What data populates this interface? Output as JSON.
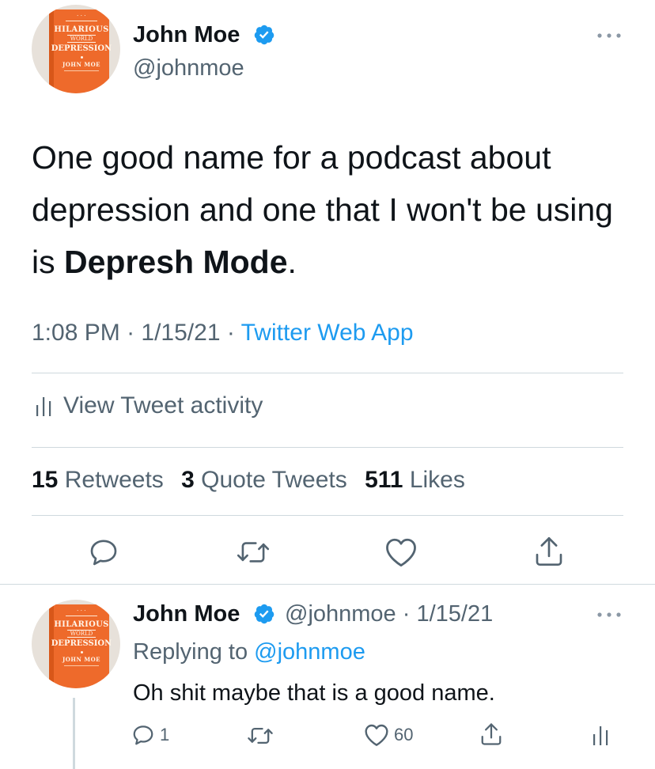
{
  "main_tweet": {
    "author_name": "John Moe",
    "author_handle": "@johnmoe",
    "text_before": "One good name for a podcast about depression and one that I won't be using is ",
    "text_bold": "Depresh Mode",
    "text_after": ".",
    "time": "1:08 PM",
    "date": "1/15/21",
    "source": "Twitter Web App",
    "separator": " · ",
    "activity_label": "View Tweet activity",
    "stats": {
      "retweets_count": "15",
      "retweets_label": "Retweets",
      "quotes_count": "3",
      "quotes_label": "Quote Tweets",
      "likes_count": "511",
      "likes_label": "Likes"
    }
  },
  "avatar_book": {
    "line1": "HILARIOUS",
    "line2": "WORLD",
    "line3": "DEPRESSION",
    "author": "JOHN MOE"
  },
  "reply_tweet": {
    "author_name": "John Moe",
    "meta": "@johnmoe · 1/15/21",
    "replying_prefix": "Replying to ",
    "replying_to": "@johnmoe",
    "text": "Oh shit maybe that is a good name.",
    "reply_count": "1",
    "retweet_count": "",
    "like_count": "60"
  },
  "colors": {
    "accent": "#1d9bf0",
    "secondary_text": "#536471",
    "primary_text": "#0f1419",
    "divider": "#cfd9de",
    "book_orange": "#ee6a2b"
  },
  "icons": {
    "verified": "verified-badge-icon",
    "more": "more-horizontal-icon",
    "activity": "bar-chart-icon",
    "reply": "reply-bubble-icon",
    "retweet": "retweet-icon",
    "like": "heart-icon",
    "share": "share-icon"
  }
}
